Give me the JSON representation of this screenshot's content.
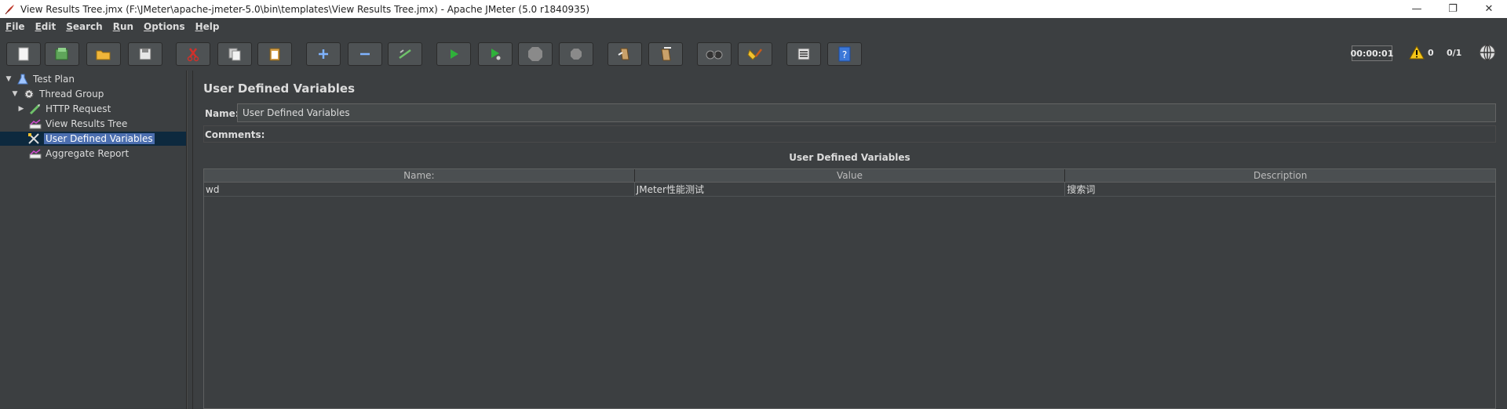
{
  "window": {
    "title": "View Results Tree.jmx (F:\\JMeter\\apache-jmeter-5.0\\bin\\templates\\View Results Tree.jmx) - Apache JMeter (5.0 r1840935)",
    "controls": {
      "minimize": "—",
      "restore": "❐",
      "close": "✕"
    }
  },
  "menu": [
    {
      "mnemonic": "F",
      "rest": "ile"
    },
    {
      "mnemonic": "E",
      "rest": "dit"
    },
    {
      "mnemonic": "S",
      "rest": "earch"
    },
    {
      "mnemonic": "R",
      "rest": "un"
    },
    {
      "mnemonic": "O",
      "rest": "ptions"
    },
    {
      "mnemonic": "H",
      "rest": "elp"
    }
  ],
  "toolbar": {
    "buttons": [
      "new-icon",
      "templates-icon",
      "open-icon",
      "save-icon",
      "cut-icon",
      "copy-icon",
      "paste-icon",
      "expand-icon",
      "collapse-icon",
      "toggle-icon",
      "start-icon",
      "start-no-timers-icon",
      "stop-icon",
      "shutdown-icon",
      "clear-icon",
      "clear-all-icon",
      "search-icon",
      "reset-search-icon",
      "function-helper-icon",
      "help-icon"
    ],
    "timer": "00:00:01",
    "warnings": "0",
    "threads": "0/1"
  },
  "tree": {
    "items": [
      {
        "label": "Test Plan",
        "icon": "test-plan-icon",
        "level": 0,
        "arrow": "▼"
      },
      {
        "label": "Thread Group",
        "icon": "thread-group-icon",
        "level": 1,
        "arrow": "▼"
      },
      {
        "label": "HTTP Request",
        "icon": "http-request-icon",
        "level": 2,
        "arrow": "▶"
      },
      {
        "label": "View Results Tree",
        "icon": "listener-icon",
        "level": 2,
        "arrow": ""
      },
      {
        "label": "User Defined Variables",
        "icon": "config-element-icon",
        "level": 2,
        "arrow": "",
        "selected": true
      },
      {
        "label": "Aggregate Report",
        "icon": "listener-icon",
        "level": 2,
        "arrow": ""
      }
    ]
  },
  "main": {
    "title": "User Defined Variables",
    "name_label": "Name:",
    "name_value": "User Defined Variables",
    "comments_label": "Comments:",
    "table_title": "User Defined Variables",
    "columns": [
      "Name:",
      "Value",
      "Description"
    ],
    "rows": [
      [
        "wd",
        "JMeter性能测试",
        "搜索词"
      ]
    ]
  },
  "colors": {
    "background": "#3c3f41",
    "selection": "#4b6eaf",
    "selection_row": "#0d293e"
  }
}
